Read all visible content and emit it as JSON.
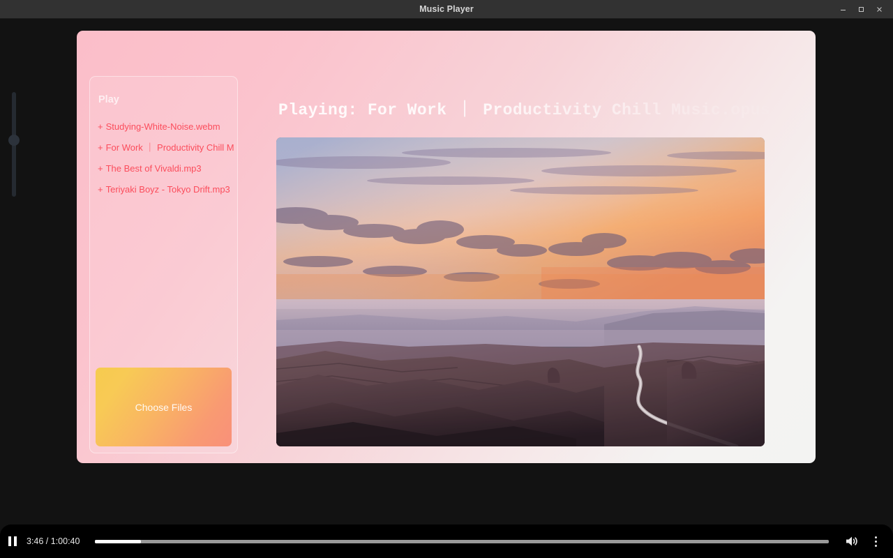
{
  "window": {
    "title": "Music Player",
    "controls": [
      {
        "name": "minimize",
        "glyph": "–"
      },
      {
        "name": "maximize",
        "glyph": "❐"
      },
      {
        "name": "close",
        "glyph": "✕"
      }
    ]
  },
  "colors": {
    "card_gradient_start": "#fbbec9",
    "card_gradient_end": "#f3f3f2",
    "playlist_text": "#fb4d5c",
    "button_gradient_start": "#f6cb4e",
    "button_gradient_end": "#f9907a",
    "titlebar_bg": "#323232",
    "page_bg": "#121212",
    "controlbar_bg": "#000000",
    "progress_fill": "#ffffff",
    "progress_track": "#9a9a9a"
  },
  "playlist": {
    "heading": "Play",
    "items": [
      {
        "prefix": "+",
        "label": "Studying-White-Noise.webm"
      },
      {
        "prefix": "+",
        "label": "For Work ｜ Productivity Chill Musi"
      },
      {
        "prefix": "+",
        "label": "The Best of Vivaldi.mp3"
      },
      {
        "prefix": "+",
        "label": "Teriyaki Boyz - Tokyo Drift.mp3"
      }
    ],
    "choose_files_label": "Choose Files"
  },
  "main": {
    "now_playing": "Playing: For Work ｜ Productivity Chill Music.opus",
    "artwork_alt": "Sunset over a deep desert canyon with a winding river"
  },
  "player": {
    "state": "playing",
    "play_pause_icon": "pause-icon",
    "current_time": "3:46",
    "total_time": "1:00:40",
    "time_display": "3:46 / 1:00:40",
    "progress_percent": 6.2,
    "volume_icon": "volume-high-icon",
    "menu_icon": "more-vertical-icon"
  }
}
